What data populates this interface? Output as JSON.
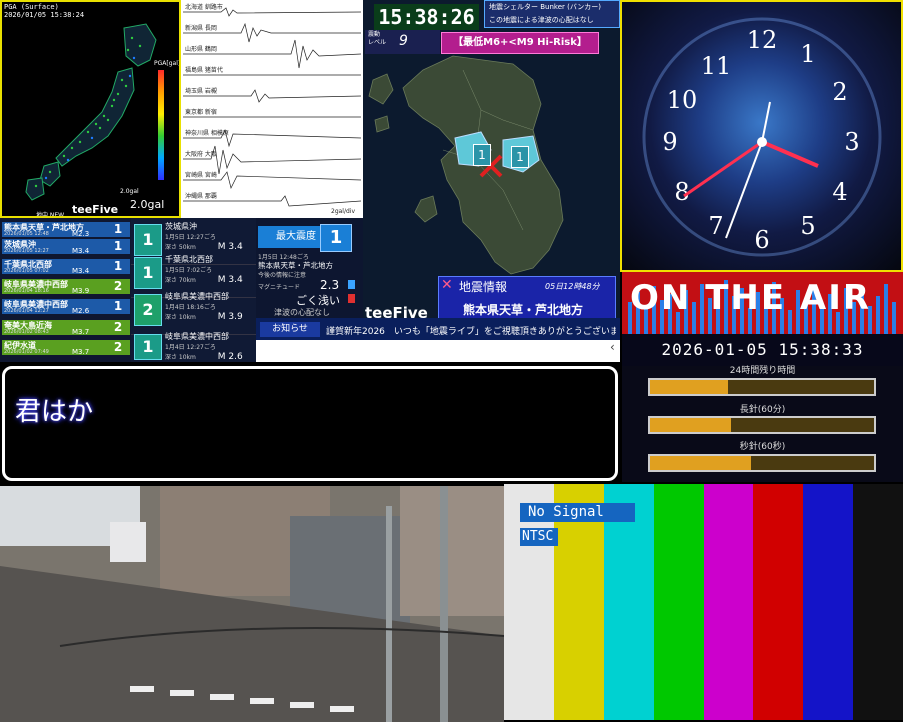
{
  "pga": {
    "header": "PGA (Surface)",
    "timestamp": "2026/01/05 15:38:24",
    "scale_label": "PGA[gal]",
    "scale_value": "2.0gal",
    "scale_small": "2.0gal",
    "brand": "teeFive",
    "new_label": "地中 NEW"
  },
  "waveform": {
    "stations": [
      "北海道 釧路市",
      "新潟県 長岡",
      "山形県 鶴岡",
      "福島県 猪苗代",
      "埼玉県 岩槻",
      "東京都 新宿",
      "神奈川県 相模原",
      "大阪府 大阪",
      "宮崎県 宮崎",
      "沖縄県 那覇"
    ],
    "footer": "2gal/div"
  },
  "quake_list": [
    {
      "name": "熊本県天草・芦北地方",
      "time": "2026/01/05 12:48",
      "mag": "M2.3",
      "intensity": "1"
    },
    {
      "name": "茨城県沖",
      "time": "2026/01/05 12:27",
      "mag": "M3.4",
      "intensity": "1"
    },
    {
      "name": "千葉県北西部",
      "time": "2026/01/05 07:02",
      "mag": "M3.4",
      "intensity": "1"
    },
    {
      "name": "岐阜県美濃中西部",
      "time": "2026/01/04 18:16",
      "mag": "M3.9",
      "intensity": "2"
    },
    {
      "name": "岐阜県美濃中西部",
      "time": "2026/01/04 12:27",
      "mag": "M2.6",
      "intensity": "1"
    },
    {
      "name": "奄美大島近海",
      "time": "2026/01/02 08:43",
      "mag": "M3.7",
      "intensity": "2"
    },
    {
      "name": "紀伊水道",
      "time": "2026/01/02 07:49",
      "mag": "M3.7",
      "intensity": "2"
    }
  ],
  "quake_detail": [
    {
      "intensity": "1",
      "place": "茨城県沖",
      "time": "1月5日 12:27ごろ",
      "depth": "深さ 50km",
      "mag": "M 3.4"
    },
    {
      "intensity": "1",
      "place": "千葉県北西部",
      "time": "1月5日 7:02ごろ",
      "depth": "深さ 70km",
      "mag": "M 3.4"
    },
    {
      "intensity": "2",
      "place": "岐阜県美濃中西部",
      "time": "1月4日 18:16ごろ",
      "depth": "深さ 10km",
      "mag": "M 3.9"
    },
    {
      "intensity": "1",
      "place": "岐阜県美濃中西部",
      "time": "1月4日 12:27ごろ",
      "depth": "深さ 10km",
      "mag": "M 2.6"
    }
  ],
  "center": {
    "max_label": "最大震度",
    "max_value": "1",
    "time": "1月5日 12:48ごろ",
    "place": "熊本県天草・芦北地方",
    "note": "今後の情報に注意",
    "mag_label": "マグニチュード",
    "mag_value": "2.3",
    "depth_value": "ごく浅い",
    "tsunami": "津波の心配なし"
  },
  "map": {
    "clock": "15:38:26",
    "level_label": "震動\nレベル",
    "level_value": "9",
    "risk": "【最低M6+<M9 Hi-Risk】",
    "bunker_title": "地震シェルター Bunker (バンカー)",
    "bunker_sub": "この地震による津波の心配はなし",
    "eq_title": "地震情報",
    "eq_time": "05日12時48分",
    "eq_place": "熊本県天草・芦北地方",
    "brand": "teeFive",
    "pin_labels": [
      "1",
      "1"
    ]
  },
  "ticker": {
    "label": "お知らせ",
    "text": "謹賀新年2026　いつも「地震ライブ」をご視聴頂きありがとうございます!"
  },
  "analog_clock": {
    "numbers": [
      "12",
      "1",
      "2",
      "3",
      "4",
      "5",
      "6",
      "7",
      "8",
      "9",
      "10",
      "11"
    ]
  },
  "on_air": {
    "text": "ON THE AIR",
    "datetime": "2026-01-05 15:38:33"
  },
  "progress": [
    {
      "label": "24時間残り時間",
      "fraction": 0.35
    },
    {
      "label": "長針(60分)",
      "fraction": 0.36
    },
    {
      "label": "秒針(60秒)",
      "fraction": 0.45
    }
  ],
  "lyrics": {
    "text": "君はか"
  },
  "test_pattern": {
    "no_signal": "No Signal",
    "standard": "NTSC",
    "colors": [
      "#e6e6e6",
      "#d8d000",
      "#00d1d1",
      "#00c800",
      "#cc00cc",
      "#d10000",
      "#1414c8",
      "#111111"
    ]
  },
  "colors": {
    "accent_yellow": "#e8e000",
    "risk_magenta": "#b31e8e",
    "on_air_red": "#c20f14"
  }
}
